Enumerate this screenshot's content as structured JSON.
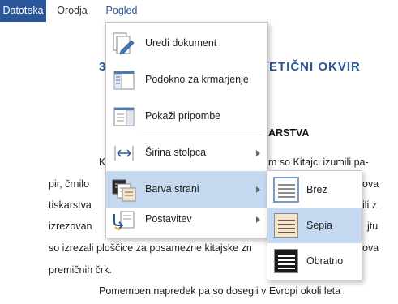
{
  "menubar": {
    "file_label": "Datoteka",
    "tools_label": "Orodja",
    "view_label": "Pogled"
  },
  "document": {
    "title_left": "3",
    "title_right": "ETIČNI OKVIR",
    "heading_right": "ARSTVA",
    "line1_left": "K",
    "line1_right": "m so Kitajci izumili pa-",
    "line2_left": "pir, črnilo",
    "line2_right": "ova",
    "line3_left": "tiskarstva",
    "line3_right": "ili z",
    "line4_left": "izrezovan",
    "line4_right": "jtu",
    "line5_left": "so izrezali ploščice za posamezne kitajske zn",
    "line5_right": "ova",
    "line6": "premičnih črk.",
    "line7": "Pomemben napredek pa so dosegli v Evropi okoli leta"
  },
  "view_menu": {
    "items": [
      {
        "label": "Uredi dokument",
        "icon": "edit-document-icon"
      },
      {
        "label": "Podokno za krmarjenje",
        "icon": "navigation-pane-icon"
      },
      {
        "label": "Pokaži pripombe",
        "icon": "show-comments-icon"
      },
      {
        "label": "Širina stolpca",
        "icon": "column-width-icon"
      },
      {
        "label": "Barva strani",
        "icon": "page-color-icon"
      },
      {
        "label": "Postavitev",
        "icon": "layout-icon"
      }
    ]
  },
  "page_color_submenu": {
    "items": [
      {
        "label": "Brez",
        "swatch_bg": "#ffffff",
        "swatch_line": "#8c8c8c"
      },
      {
        "label": "Sepia",
        "swatch_bg": "#f5e4cc",
        "swatch_line": "#6b5a45"
      },
      {
        "label": "Obratno",
        "swatch_bg": "#1a1a1a",
        "swatch_line": "#ffffff"
      }
    ]
  },
  "colors": {
    "accent": "#2b579a",
    "highlight": "#c5d9f1"
  }
}
